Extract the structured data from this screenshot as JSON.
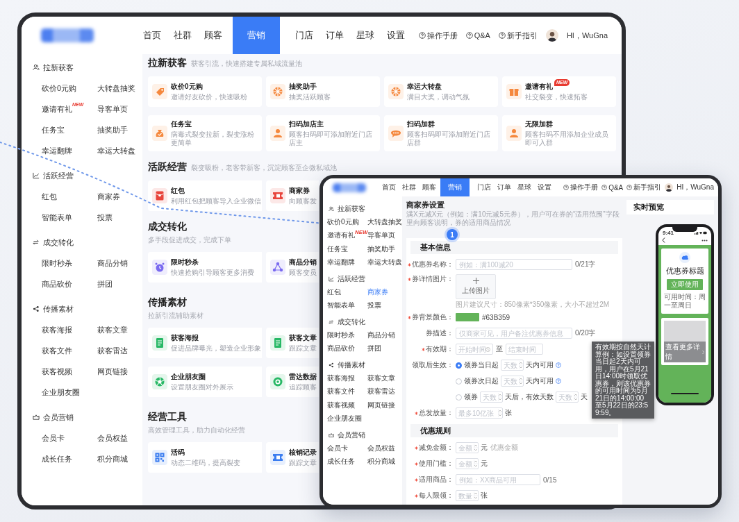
{
  "back_window": {
    "nav": {
      "items": [
        {
          "label": "首页",
          "selected": false
        },
        {
          "label": "社群",
          "selected": false
        },
        {
          "label": "顾客",
          "selected": false
        },
        {
          "label": "营销",
          "selected": true
        },
        {
          "label": "门店",
          "selected": false
        },
        {
          "label": "订单",
          "selected": false
        },
        {
          "label": "星球",
          "selected": false
        },
        {
          "label": "设置",
          "selected": false
        }
      ],
      "help_links": [
        "操作手册",
        "Q&A",
        "新手指引"
      ],
      "greeting": "HI，WuGna"
    },
    "sidebar": {
      "groups": [
        {
          "title": "拉新获客",
          "items": [
            {
              "label": "砍价0元购",
              "selected": false
            },
            {
              "label": "大转盘抽奖",
              "selected": false
            },
            {
              "label": "邀请有礼",
              "selected": false,
              "badge": "NEW"
            },
            {
              "label": "导客单页",
              "selected": false
            },
            {
              "label": "任务宝",
              "selected": false
            },
            {
              "label": "抽奖助手",
              "selected": false
            },
            {
              "label": "幸运翻牌",
              "selected": false
            },
            {
              "label": "幸运大转盘",
              "selected": false
            }
          ]
        },
        {
          "title": "活跃经营",
          "items": [
            {
              "label": "红包",
              "selected": false
            },
            {
              "label": "商家券",
              "selected": false
            },
            {
              "label": "智能表单",
              "selected": false
            },
            {
              "label": "投票",
              "selected": false
            }
          ]
        },
        {
          "title": "成交转化",
          "items": [
            {
              "label": "限时秒杀",
              "selected": false
            },
            {
              "label": "商品分销",
              "selected": false
            },
            {
              "label": "商品砍价",
              "selected": false
            },
            {
              "label": "拼团",
              "selected": false
            }
          ]
        },
        {
          "title": "传播素材",
          "items": [
            {
              "label": "获客海报",
              "selected": false
            },
            {
              "label": "获客文章",
              "selected": false
            },
            {
              "label": "获客文件",
              "selected": false
            },
            {
              "label": "获客雷达",
              "selected": false
            },
            {
              "label": "获客视频",
              "selected": false
            },
            {
              "label": "网页链接",
              "selected": false
            },
            {
              "label": "企业朋友圈",
              "selected": false
            }
          ]
        },
        {
          "title": "会员营销",
          "items": [
            {
              "label": "会员卡",
              "selected": false
            },
            {
              "label": "会员权益",
              "selected": false
            },
            {
              "label": "成长任务",
              "selected": false
            },
            {
              "label": "积分商城",
              "selected": false
            }
          ]
        }
      ]
    },
    "sections": [
      {
        "title": "拉新获客",
        "subtitle": "获客引流，快速搭建专属私域流量池",
        "kind": "inline",
        "rows": [
          [
            {
              "title": "砍价0元购",
              "description": "邀请好友砍价，快速吸粉",
              "color": "#f5883d"
            },
            {
              "title": "抽奖助手",
              "description": "抽奖活跃顾客",
              "color": "#f5883d"
            },
            {
              "title": "幸运大转盘",
              "description": "满目大奖，调动气氛",
              "color": "#f5883d"
            },
            {
              "title": "邀请有礼",
              "description": "社交裂变，快速拓客",
              "color": "#f5883d",
              "badge": "NEW"
            }
          ],
          [
            {
              "title": "任务宝",
              "description": "病毒式裂变拉新，裂变涨粉更简单",
              "color": "#f5883d"
            },
            {
              "title": "扫码加店主",
              "description": "顾客扫码即可添加附近门店店主",
              "color": "#f5883d"
            },
            {
              "title": "扫码加群",
              "description": "顾客扫码即可添加附近门店店群",
              "color": "#f5883d"
            },
            {
              "title": "无限加群",
              "description": "顾客扫码不用添加企业成员即可入群",
              "color": "#f5883d"
            }
          ]
        ]
      },
      {
        "title": "活跃经营",
        "subtitle": "裂变吸粉，老客带新客，沉淀顾客至企微私域池",
        "kind": "inline",
        "rows": [
          [
            {
              "title": "红包",
              "description": "利用红包把顾客导入企业微信",
              "color": "#e8453c"
            },
            {
              "title": "商家券",
              "description": "向顾客发",
              "color": "#e8453c"
            }
          ]
        ]
      },
      {
        "title": "成交转化",
        "subtitle": "多手段促进成交，完成下单",
        "kind": "stacked",
        "rows": [
          [
            {
              "title": "限时秒杀",
              "description": "快速抢购引导顾客更多消费",
              "color": "#7a6af0"
            },
            {
              "title": "商品分销",
              "description": "顾客变员",
              "color": "#7a6af0"
            }
          ]
        ]
      },
      {
        "title": "传播素材",
        "subtitle": "拉新引流辅助素材",
        "kind": "stacked",
        "rows": [
          [
            {
              "title": "获客海报",
              "description": "促进品牌曝光，塑造企业形象",
              "color": "#27b865"
            },
            {
              "title": "获客文章",
              "description": "跟踪文章",
              "color": "#27b865"
            }
          ],
          [
            {
              "title": "企业朋友圈",
              "description": "设置朋友圈对外展示",
              "color": "#27b865"
            },
            {
              "title": "雷达数据",
              "description": "追踪顾客",
              "color": "#27b865"
            }
          ]
        ]
      },
      {
        "title": "经营工具",
        "subtitle": "高效管理工具，助力自动化经营",
        "kind": "stacked",
        "rows": [
          [
            {
              "title": "活码",
              "description": "动态二维码，提高裂变",
              "color": "#3b7df0"
            },
            {
              "title": "核销记录",
              "description": "跟踪文章",
              "color": "#3b7df0"
            }
          ]
        ]
      }
    ]
  },
  "connector": {
    "badge": "1"
  },
  "front_window": {
    "nav": {
      "items": [
        {
          "label": "首页",
          "selected": false
        },
        {
          "label": "社群",
          "selected": false
        },
        {
          "label": "顾客",
          "selected": false
        },
        {
          "label": "营销",
          "selected": true
        },
        {
          "label": "门店",
          "selected": false
        },
        {
          "label": "订单",
          "selected": false
        },
        {
          "label": "星球",
          "selected": false
        },
        {
          "label": "设置",
          "selected": false
        }
      ],
      "help_links": [
        "操作手册",
        "Q&A",
        "新手指引"
      ],
      "greeting": "HI，WuGna"
    },
    "sidebar": {
      "groups": [
        {
          "title": "拉新获客",
          "items": [
            {
              "label": "砍价0元购",
              "selected": false
            },
            {
              "label": "大转盘抽奖",
              "selected": false
            },
            {
              "label": "邀请有礼",
              "selected": false,
              "badge": "NEW"
            },
            {
              "label": "导客单页",
              "selected": false
            },
            {
              "label": "任务宝",
              "selected": false
            },
            {
              "label": "抽奖助手",
              "selected": false
            },
            {
              "label": "幸运翻牌",
              "selected": false
            },
            {
              "label": "幸运大转盘",
              "selected": false
            }
          ]
        },
        {
          "title": "活跃经营",
          "items": [
            {
              "label": "红包",
              "selected": false
            },
            {
              "label": "商家券",
              "selected": true
            },
            {
              "label": "智能表单",
              "selected": false
            },
            {
              "label": "投票",
              "selected": false
            }
          ]
        },
        {
          "title": "成交转化",
          "items": [
            {
              "label": "限时秒杀",
              "selected": false
            },
            {
              "label": "商品分销",
              "selected": false
            },
            {
              "label": "商品砍价",
              "selected": false
            },
            {
              "label": "拼团",
              "selected": false
            }
          ]
        },
        {
          "title": "传播素材",
          "items": [
            {
              "label": "获客海报",
              "selected": false
            },
            {
              "label": "获客文章",
              "selected": false
            },
            {
              "label": "获客文件",
              "selected": false
            },
            {
              "label": "获客雷达",
              "selected": false
            },
            {
              "label": "获客视频",
              "selected": false
            },
            {
              "label": "网页链接",
              "selected": false
            },
            {
              "label": "企业朋友圈",
              "selected": false
            }
          ]
        },
        {
          "title": "会员营销",
          "items": [
            {
              "label": "会员卡",
              "selected": false
            },
            {
              "label": "会员权益",
              "selected": false
            },
            {
              "label": "成长任务",
              "selected": false
            },
            {
              "label": "积分商城",
              "selected": false
            }
          ]
        }
      ]
    },
    "form": {
      "title": "商家券设置",
      "description": "满X元减X元（例如：满10元减5元券），用户可在券的“适用范围”字段里向顾客说明，券的适用商品情况",
      "sections": [
        {
          "title": "基本信息",
          "fields": [
            {
              "kind": "text",
              "label": "优惠券名称：",
              "required": true,
              "placeholder": "例如：满100减20",
              "counter": "0/21字"
            },
            {
              "kind": "upload",
              "label": "券详情图片：",
              "required": true,
              "button": "上传图片",
              "hint": "图片建议尺寸：850像素*350像素，大小不超过2M"
            },
            {
              "kind": "color",
              "label": "券背景颜色：",
              "required": true,
              "value": "#63B359",
              "color": "#63b359"
            },
            {
              "kind": "text",
              "label": "券描述：",
              "required": false,
              "placeholder": "仅商家可见，用户备注优惠券信息",
              "counter": "0/20字"
            },
            {
              "kind": "date_range",
              "label": "有效期：",
              "required": true,
              "start_placeholder": "开始时间",
              "separator": "至",
              "end_placeholder": "结束时间"
            },
            {
              "kind": "radio_group",
              "label": "领取后生效：",
              "required": false,
              "tooltip": "有效期按自然天计算例：如设置领券当日起2天内可用，用户在5月21日14:00时领取优惠券，则该优惠券的可用时间为5月21日的14:00:00至5月22日的23:59:59。",
              "options": [
                {
                  "selected": true,
                  "parts": [
                    {
                      "kind": "text",
                      "text": "领券当日起"
                    },
                    {
                      "kind": "number",
                      "placeholder": "天数"
                    },
                    {
                      "kind": "text",
                      "text": "天内可用"
                    },
                    {
                      "kind": "help"
                    }
                  ]
                },
                {
                  "selected": false,
                  "parts": [
                    {
                      "kind": "text",
                      "text": "领券次日起"
                    },
                    {
                      "kind": "number",
                      "placeholder": "天数"
                    },
                    {
                      "kind": "text",
                      "text": "天内可用"
                    },
                    {
                      "kind": "help"
                    }
                  ]
                },
                {
                  "selected": false,
                  "parts": [
                    {
                      "kind": "text",
                      "text": "领券"
                    },
                    {
                      "kind": "number",
                      "placeholder": "天数"
                    },
                    {
                      "kind": "text",
                      "text": "天后，有效天数"
                    },
                    {
                      "kind": "number",
                      "placeholder": "天数"
                    },
                    {
                      "kind": "text",
                      "text": "天"
                    }
                  ]
                }
              ]
            },
            {
              "kind": "number",
              "label": "总发放量：",
              "required": true,
              "placeholder": "最多10亿张",
              "unit": "张"
            }
          ]
        },
        {
          "title": "优惠规则",
          "fields": [
            {
              "kind": "number",
              "label": "减免金额：",
              "required": true,
              "placeholder": "金额",
              "unit": "元",
              "note": "优惠金额"
            },
            {
              "kind": "number",
              "label": "使用门槛：",
              "required": true,
              "placeholder": "金额",
              "unit": "元"
            },
            {
              "kind": "text",
              "label": "适用商品：",
              "required": true,
              "placeholder": "例如：XX商品可用",
              "counter": "0/15"
            },
            {
              "kind": "number",
              "label": "每人限领：",
              "required": true,
              "placeholder": "数量",
              "unit": "张"
            }
          ]
        }
      ]
    },
    "preview": {
      "title": "实时预览",
      "phone": {
        "time": "9:41",
        "coupon_title": "优惠券标题",
        "button": "立即使用",
        "usage": "可用时间：周一至周日",
        "details": "查看更多详情"
      }
    }
  }
}
